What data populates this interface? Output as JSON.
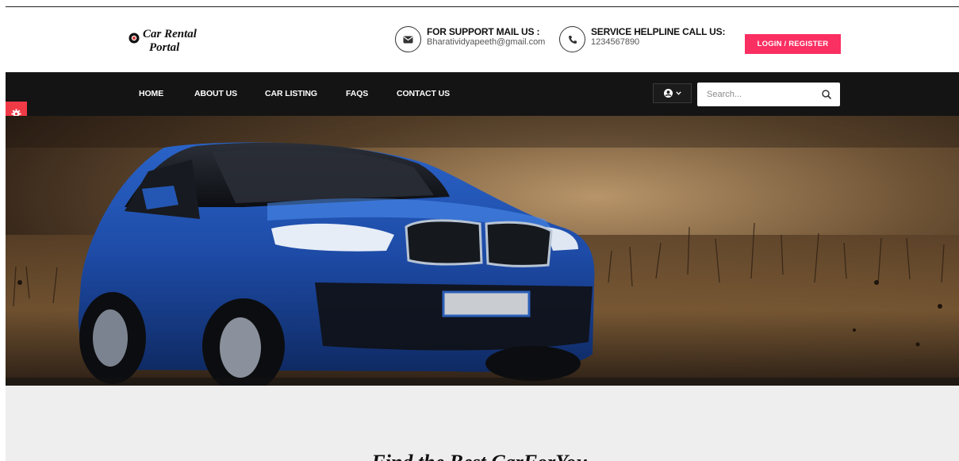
{
  "brand": {
    "line1": "Car Rental",
    "line2": "Portal"
  },
  "support": {
    "title": "FOR SUPPORT MAIL US :",
    "value": "Bharatividyapeeth@gmail.com",
    "icon": "envelope-icon"
  },
  "helpline": {
    "title": "SERVICE HELPLINE CALL US:",
    "value": "1234567890",
    "icon": "phone-icon"
  },
  "login": {
    "label": "LOGIN / REGISTER"
  },
  "nav": {
    "items": [
      {
        "label": "HOME"
      },
      {
        "label": "ABOUT US"
      },
      {
        "label": "CAR LISTING"
      },
      {
        "label": "FAQS"
      },
      {
        "label": "CONTACT US"
      }
    ]
  },
  "search": {
    "placeholder": "Search..."
  },
  "section": {
    "title": "Find the Best CarForYou"
  },
  "colors": {
    "accent": "#fa2f62",
    "nav_bg": "#141414",
    "settings_tab": "#f03b47",
    "band": "#eeeeee"
  }
}
